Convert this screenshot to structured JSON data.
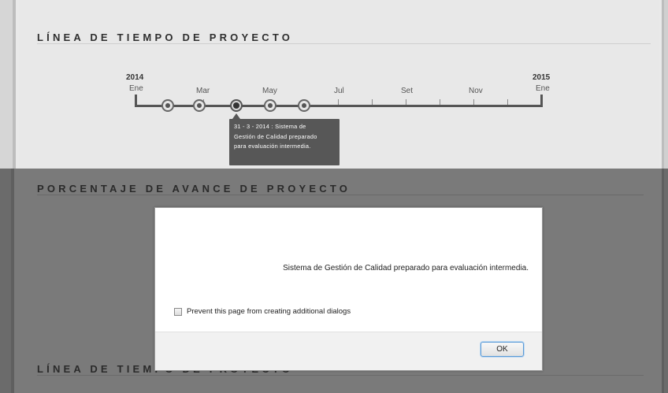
{
  "timeline_section": {
    "title": "LÍNEA DE TIEMPO DE PROYECTO",
    "start_year": "2014",
    "end_year": "2015",
    "months": [
      "Ene",
      "Mar",
      "May",
      "Jul",
      "Set",
      "Nov",
      "Ene"
    ],
    "tooltip": {
      "lines": [
        "31 - 3 - 2014 : Sistema de",
        "Gestión de Calidad preparado",
        "para evaluación intermedia."
      ]
    }
  },
  "progress_section": {
    "title": "PORCENTAJE DE AVANCE DE PROYECTO"
  },
  "bottom_section": {
    "title": "LÍNEA DE TIEMPO DE PROYECTO"
  },
  "dialog": {
    "message": "Sistema de Gestión de Calidad preparado para evaluación intermedia.",
    "prevent_label": "Prevent this page from creating additional dialogs",
    "prevent_checked": false,
    "ok_label": "OK"
  },
  "colors": {
    "overlay": "#7a7a7a",
    "panel": "#e8e8e8",
    "tooltip": "#575757",
    "focus": "#5a9ad6"
  }
}
